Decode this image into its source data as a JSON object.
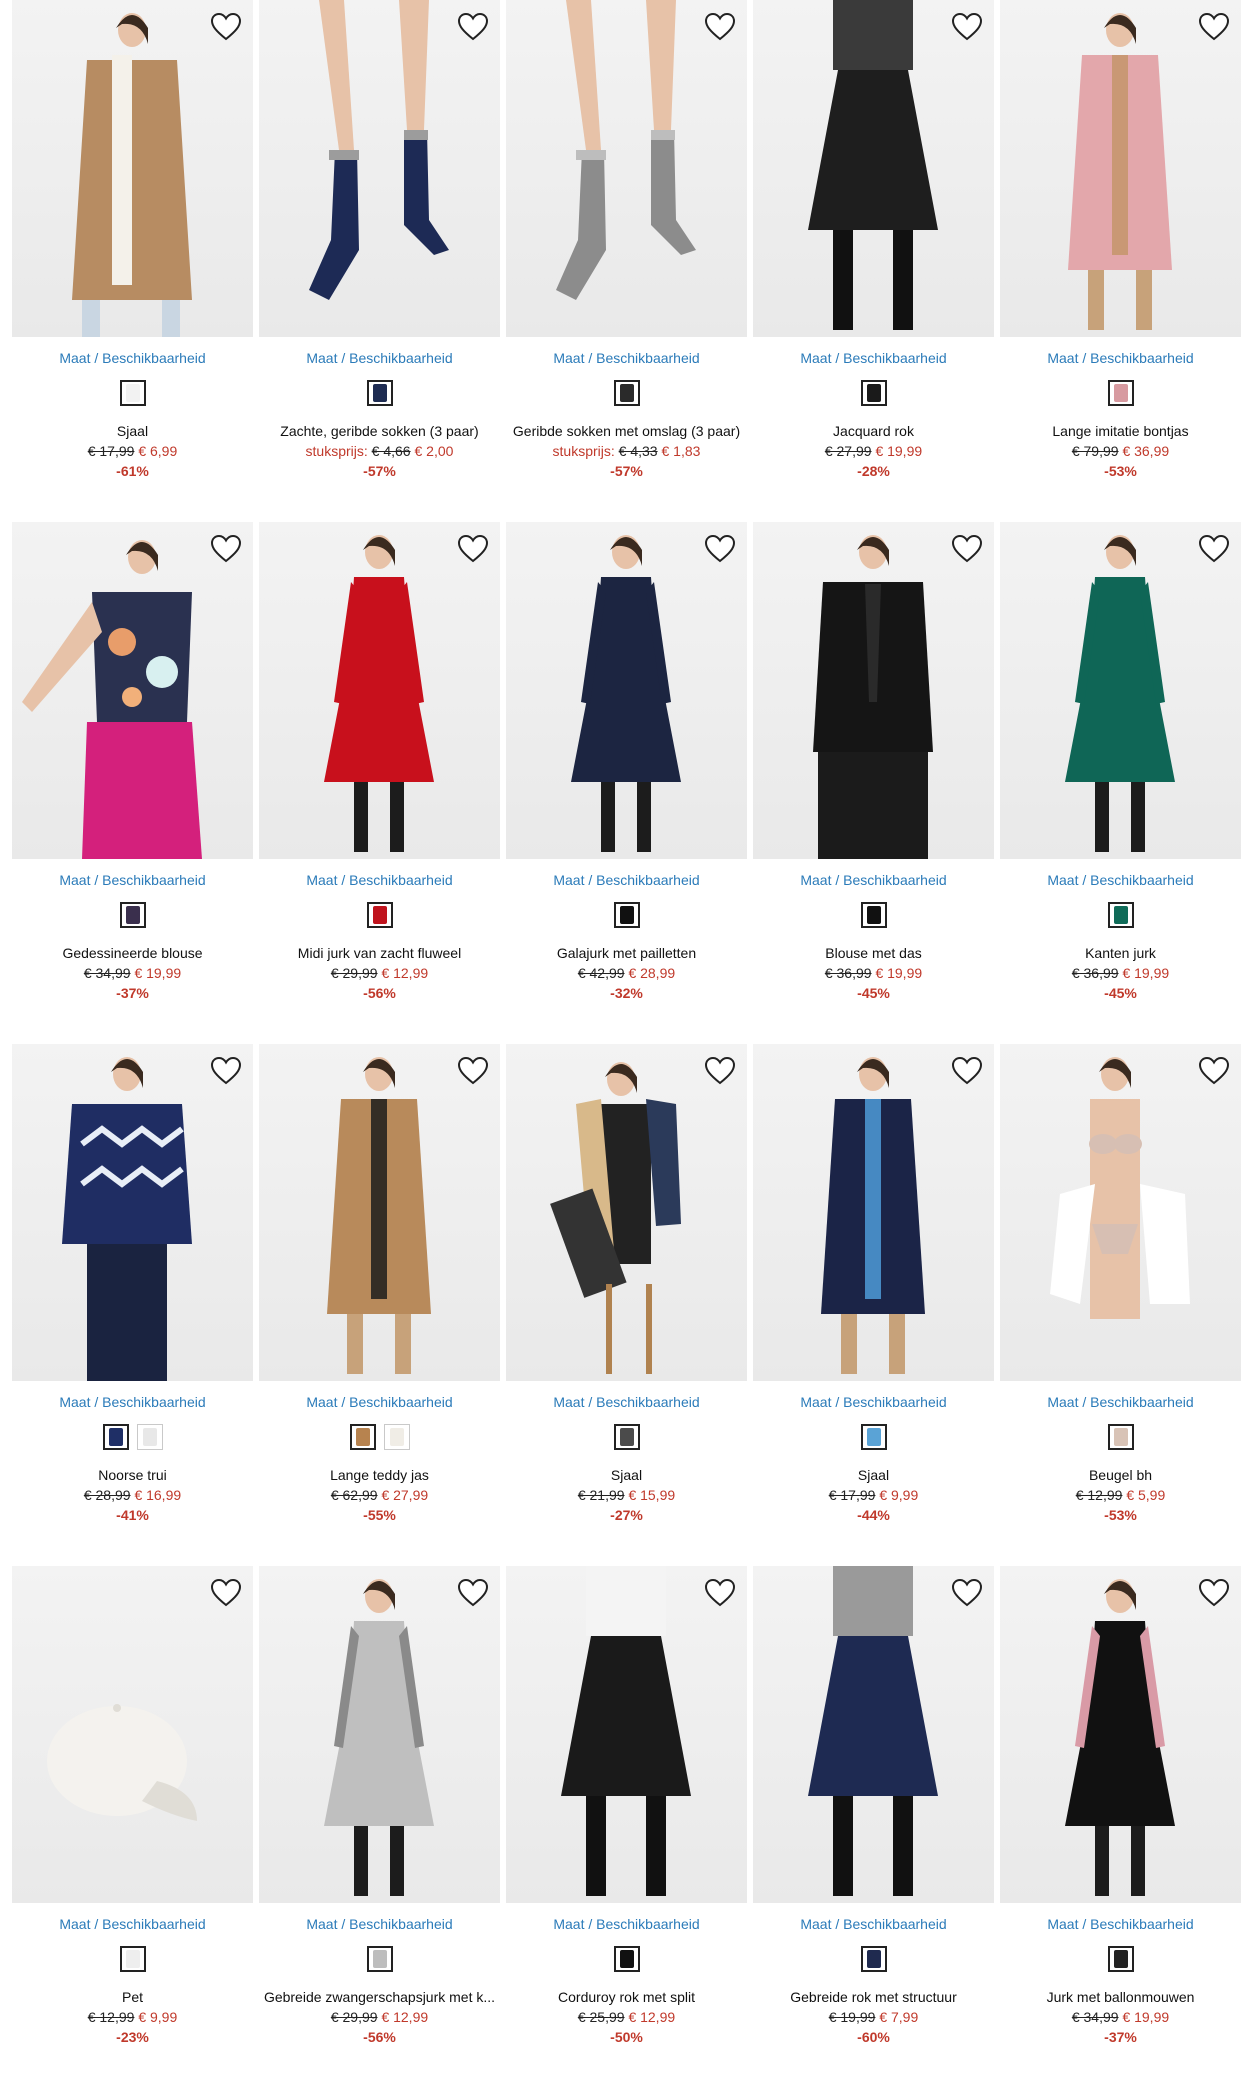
{
  "products": [
    {
      "size_link": "Maat / Beschikbaarheid",
      "swatches": [
        "#f2f2f2"
      ],
      "name": "Sjaal",
      "unit_label": "",
      "old_price": "€ 17,99",
      "new_price": "€ 6,99",
      "discount": "-61%",
      "img": "coat",
      "colors": {
        "main": "#b78c62",
        "accent": "#f4f1ea"
      }
    },
    {
      "size_link": "Maat / Beschikbaarheid",
      "swatches": [
        "#1e2c52"
      ],
      "name": "Zachte, geribde sokken (3 paar)",
      "unit_label": "stuksprijs:",
      "old_price": "€ 4,66",
      "new_price": "€ 2,00",
      "discount": "-57%",
      "img": "socks",
      "colors": {
        "main": "#1d2a55",
        "accent": "#9c9c9c"
      }
    },
    {
      "size_link": "Maat / Beschikbaarheid",
      "swatches": [
        "#2a2a2a"
      ],
      "name": "Geribde sokken met omslag (3 paar)",
      "unit_label": "stuksprijs:",
      "old_price": "€ 4,33",
      "new_price": "€ 1,83",
      "discount": "-57%",
      "img": "socks",
      "colors": {
        "main": "#8c8c8c",
        "accent": "#bdbdbd"
      }
    },
    {
      "size_link": "Maat / Beschikbaarheid",
      "swatches": [
        "#1a1a1a"
      ],
      "name": "Jacquard rok",
      "unit_label": "",
      "old_price": "€ 27,99",
      "new_price": "€ 19,99",
      "discount": "-28%",
      "img": "skirt",
      "colors": {
        "main": "#1e1e1e",
        "accent": "#3a3a3a"
      }
    },
    {
      "size_link": "Maat / Beschikbaarheid",
      "swatches": [
        "#d79aa0"
      ],
      "name": "Lange imitatie bontjas",
      "unit_label": "",
      "old_price": "€ 79,99",
      "new_price": "€ 36,99",
      "discount": "-53%",
      "img": "longcoat",
      "colors": {
        "main": "#e3a7ab",
        "accent": "#c4956a"
      }
    },
    {
      "size_link": "Maat / Beschikbaarheid",
      "swatches": [
        "#3a2f4d"
      ],
      "name": "Gedessineerde blouse",
      "unit_label": "",
      "old_price": "€ 34,99",
      "new_price": "€ 19,99",
      "discount": "-37%",
      "img": "blouse",
      "colors": {
        "main": "#2a3150",
        "accent": "#d4207c"
      }
    },
    {
      "size_link": "Maat / Beschikbaarheid",
      "swatches": [
        "#c0141e"
      ],
      "name": "Midi jurk van zacht fluweel",
      "unit_label": "",
      "old_price": "€ 29,99",
      "new_price": "€ 12,99",
      "discount": "-56%",
      "img": "dress",
      "colors": {
        "main": "#c8101c",
        "accent": "#1c1c1c"
      }
    },
    {
      "size_link": "Maat / Beschikbaarheid",
      "swatches": [
        "#111111"
      ],
      "name": "Galajurk met pailletten",
      "unit_label": "",
      "old_price": "€ 42,99",
      "new_price": "€ 28,99",
      "discount": "-32%",
      "img": "dress",
      "colors": {
        "main": "#1c2541",
        "accent": "#1c1c1c"
      }
    },
    {
      "size_link": "Maat / Beschikbaarheid",
      "swatches": [
        "#111111"
      ],
      "name": "Blouse met das",
      "unit_label": "",
      "old_price": "€ 36,99",
      "new_price": "€ 19,99",
      "discount": "-45%",
      "img": "blackset",
      "colors": {
        "main": "#151515",
        "accent": "#2a2a2a"
      }
    },
    {
      "size_link": "Maat / Beschikbaarheid",
      "swatches": [
        "#0f6b58"
      ],
      "name": "Kanten jurk",
      "unit_label": "",
      "old_price": "€ 36,99",
      "new_price": "€ 19,99",
      "discount": "-45%",
      "img": "dress",
      "colors": {
        "main": "#0f6656",
        "accent": "#1c1c1c"
      }
    },
    {
      "size_link": "Maat / Beschikbaarheid",
      "swatches": [
        "#1f2f66",
        "#e8e8e8"
      ],
      "name": "Noorse trui",
      "unit_label": "",
      "old_price": "€ 28,99",
      "new_price": "€ 16,99",
      "discount": "-41%",
      "img": "sweater",
      "colors": {
        "main": "#1f2d63",
        "accent": "#e8eef7"
      }
    },
    {
      "size_link": "Maat / Beschikbaarheid",
      "swatches": [
        "#b7834f",
        "#f0ede6"
      ],
      "name": "Lange teddy jas",
      "unit_label": "",
      "old_price": "€ 62,99",
      "new_price": "€ 27,99",
      "discount": "-55%",
      "img": "longcoat",
      "colors": {
        "main": "#b88a5b",
        "accent": "#1c1c1c"
      }
    },
    {
      "size_link": "Maat / Beschikbaarheid",
      "swatches": [
        "#4b4b4b"
      ],
      "name": "Sjaal",
      "unit_label": "",
      "old_price": "€ 21,99",
      "new_price": "€ 15,99",
      "discount": "-27%",
      "img": "scarfset",
      "colors": {
        "main": "#2b3a5a",
        "accent": "#d8b98a"
      }
    },
    {
      "size_link": "Maat / Beschikbaarheid",
      "swatches": [
        "#5aa3d6"
      ],
      "name": "Sjaal",
      "unit_label": "",
      "old_price": "€ 17,99",
      "new_price": "€ 9,99",
      "discount": "-44%",
      "img": "longcoat",
      "colors": {
        "main": "#1b2447",
        "accent": "#4e9bd8"
      }
    },
    {
      "size_link": "Maat / Beschikbaarheid",
      "swatches": [
        "#d8c3b6"
      ],
      "name": "Beugel bh",
      "unit_label": "",
      "old_price": "€ 12,99",
      "new_price": "€ 5,99",
      "discount": "-53%",
      "img": "lingerie",
      "colors": {
        "main": "#d7bfb3",
        "accent": "#ffffff"
      }
    },
    {
      "size_link": "Maat / Beschikbaarheid",
      "swatches": [
        "#eeeeee"
      ],
      "name": "Pet",
      "unit_label": "",
      "old_price": "€ 12,99",
      "new_price": "€ 9,99",
      "discount": "-23%",
      "img": "cap",
      "colors": {
        "main": "#f4f2ee",
        "accent": "#e0ddd6"
      }
    },
    {
      "size_link": "Maat / Beschikbaarheid",
      "swatches": [
        "#bdbdbd"
      ],
      "name": "Gebreide zwangerschapsjurk met k...",
      "unit_label": "",
      "old_price": "€ 29,99",
      "new_price": "€ 12,99",
      "discount": "-56%",
      "img": "dress",
      "colors": {
        "main": "#bfbfbf",
        "accent": "#8a8a8a"
      }
    },
    {
      "size_link": "Maat / Beschikbaarheid",
      "swatches": [
        "#111111"
      ],
      "name": "Corduroy rok met split",
      "unit_label": "",
      "old_price": "€ 25,99",
      "new_price": "€ 12,99",
      "discount": "-50%",
      "img": "skirt",
      "colors": {
        "main": "#1a1a1a",
        "accent": "#f4f4f4"
      }
    },
    {
      "size_link": "Maat / Beschikbaarheid",
      "swatches": [
        "#1f2a4f"
      ],
      "name": "Gebreide rok met structuur",
      "unit_label": "",
      "old_price": "€ 19,99",
      "new_price": "€ 7,99",
      "discount": "-60%",
      "img": "skirt",
      "colors": {
        "main": "#1e2a52",
        "accent": "#9a9a9a"
      }
    },
    {
      "size_link": "Maat / Beschikbaarheid",
      "swatches": [
        "#222222"
      ],
      "name": "Jurk met ballonmouwen",
      "unit_label": "",
      "old_price": "€ 34,99",
      "new_price": "€ 19,99",
      "discount": "-37%",
      "img": "dress",
      "colors": {
        "main": "#111111",
        "accent": "#d99aa6"
      }
    }
  ]
}
